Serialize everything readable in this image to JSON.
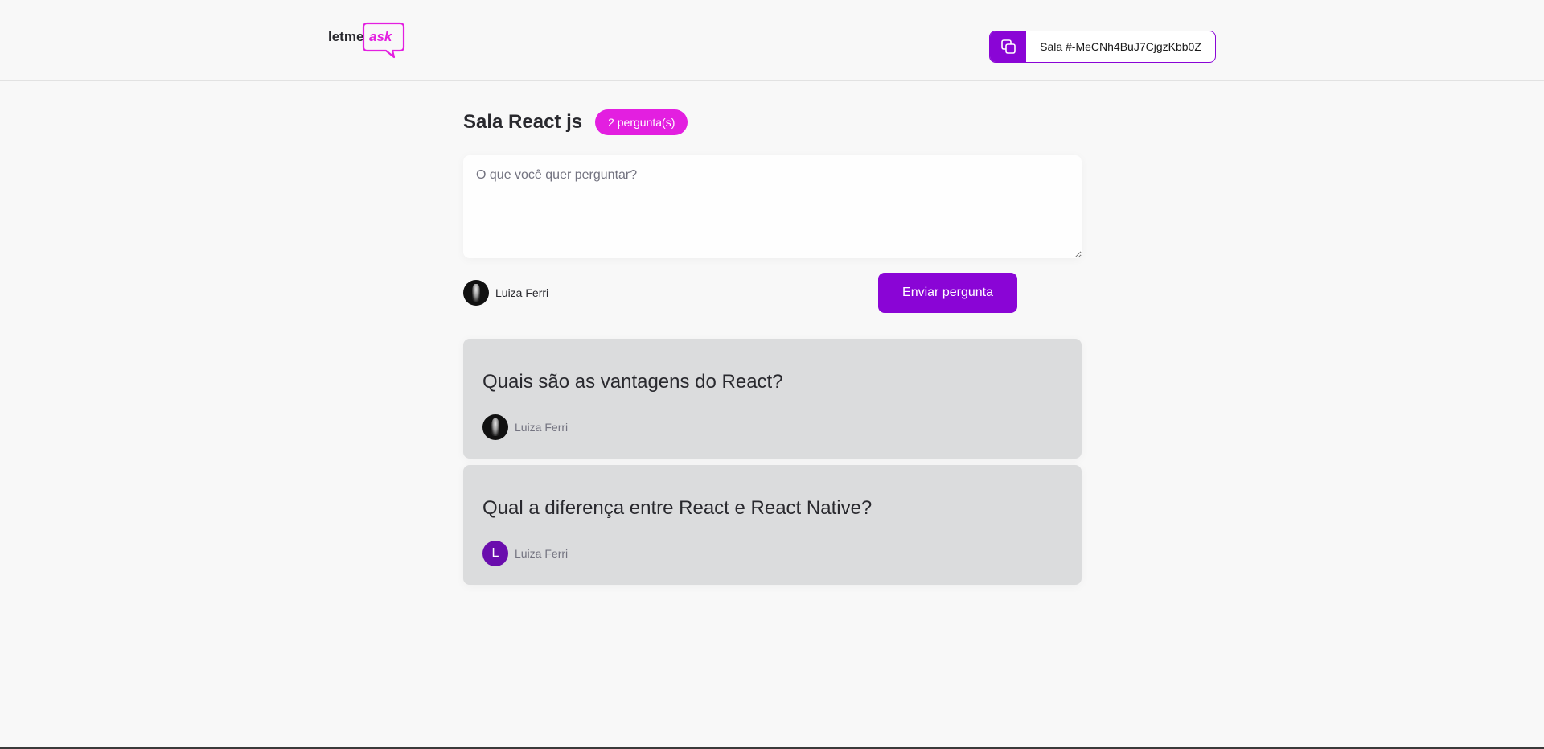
{
  "header": {
    "logo_text_main": "letme",
    "logo_text_accent": "ask",
    "room_code_label": "Sala #-MeCNh4BuJ7CjgzKbb0Z",
    "copy_icon": "copy-icon"
  },
  "room": {
    "title": "Sala React js",
    "question_count_badge": "2 pergunta(s)"
  },
  "form": {
    "placeholder": "O que você quer perguntar?",
    "value": "",
    "user_name": "Luiza Ferri",
    "submit_label": "Enviar pergunta"
  },
  "questions": [
    {
      "content": "Quais são as vantagens do React?",
      "author_name": "Luiza Ferri",
      "avatar_type": "photo"
    },
    {
      "content": "Qual a diferença entre React e React Native?",
      "author_name": "Luiza Ferri",
      "avatar_type": "initial",
      "avatar_initial": "L"
    }
  ],
  "colors": {
    "primary": "#8a05d6",
    "badge": "#e31fe0",
    "card_background": "#dbdcdd",
    "page_background": "#f8f8f8"
  }
}
